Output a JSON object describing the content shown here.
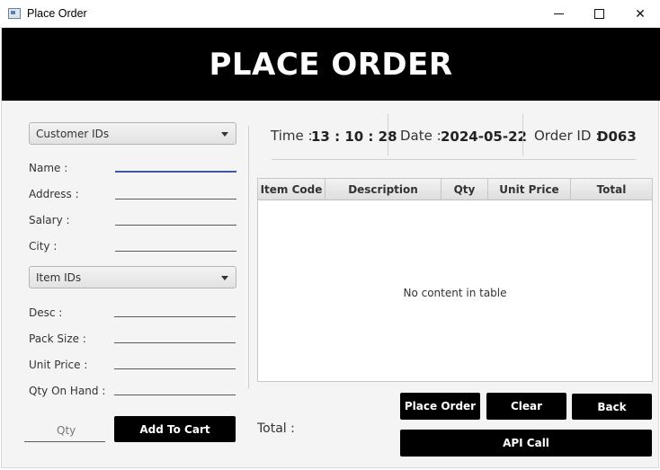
{
  "window": {
    "title": "Place Order",
    "min": "—",
    "max": "☐",
    "close": "✕"
  },
  "header": {
    "title": "PLACE ORDER"
  },
  "customer": {
    "combo_label": "Customer IDs",
    "fields": [
      {
        "label": "Name :"
      },
      {
        "label": "Address :"
      },
      {
        "label": "Salary :"
      },
      {
        "label": "City :"
      }
    ]
  },
  "item": {
    "combo_label": "Item IDs",
    "fields": [
      {
        "label": "Desc :"
      },
      {
        "label": "Pack Size :"
      },
      {
        "label": "Unit Price :"
      },
      {
        "label": "Qty On Hand :"
      }
    ],
    "qty_placeholder": "Qty",
    "add_to_cart": "Add To Cart"
  },
  "info": {
    "time_label": "Time :",
    "time_value": "13 : 10 : 28",
    "date_label": "Date :",
    "date_value": "2024-05-22",
    "order_label": "Order ID :",
    "order_value": "D063"
  },
  "table": {
    "columns": [
      "Item Code",
      "Description",
      "Qty",
      "Unit Price",
      "Total"
    ],
    "empty_message": "No content in table"
  },
  "footer": {
    "total_label": "Total :",
    "place_order": "Place Order",
    "clear": "Clear",
    "back": "Back",
    "api_call": "API Call"
  }
}
